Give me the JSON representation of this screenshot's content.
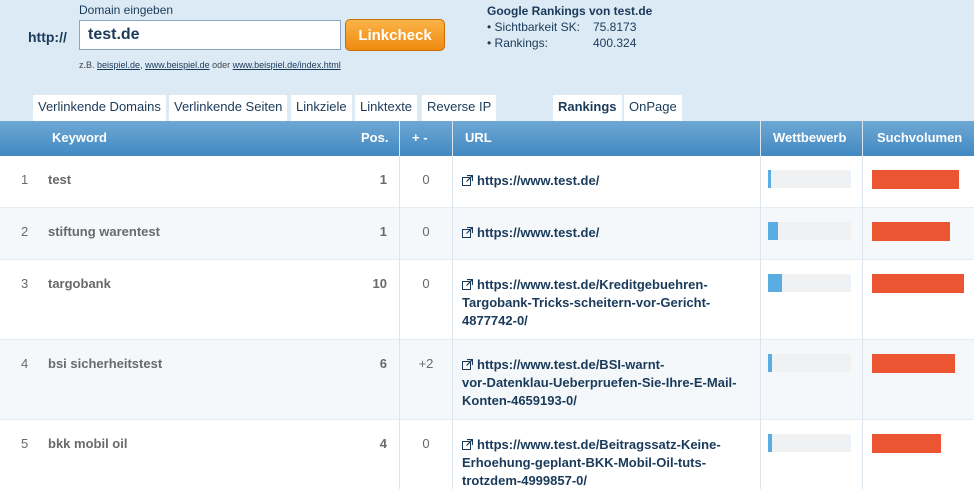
{
  "header": {
    "http_prefix": "http://",
    "domain_label": "Domain eingeben",
    "domain_value": "test.de",
    "check_button": "Linkcheck",
    "examples_prefix": "z.B.",
    "example_links": [
      "beispiel.de",
      "www.beispiel.de",
      "www.beispiel.de/index.html"
    ],
    "examples_sep1": ", ",
    "examples_sep2": " oder "
  },
  "rankings_summary": {
    "title": "Google Rankings von test.de",
    "visibility_label": "• Sichtbarkeit SK:",
    "visibility_value": "75.8173",
    "rankings_label": "• Rankings:",
    "rankings_value": "400.324"
  },
  "tabs": [
    {
      "label": "Verlinkende Domains",
      "active": false
    },
    {
      "label": "Verlinkende Seiten",
      "active": false
    },
    {
      "label": "Linkziele",
      "active": false
    },
    {
      "label": "Linktexte",
      "active": false
    },
    {
      "label": "Reverse IP",
      "active": false
    },
    {
      "label": "Rankings",
      "active": true
    },
    {
      "label": "OnPage",
      "active": false
    }
  ],
  "table": {
    "columns": {
      "keyword": "Keyword",
      "pos": "Pos.",
      "change": "+ -",
      "url": "URL",
      "competition": "Wettbewerb",
      "volume": "Suchvolumen"
    },
    "rows": [
      {
        "num": "1",
        "keyword": "test",
        "pos": "1",
        "change": "0",
        "url": [
          "https://www.test.de/"
        ],
        "competition": 0.0,
        "volume": 0.95
      },
      {
        "num": "2",
        "keyword": "stiftung warentest",
        "pos": "1",
        "change": "0",
        "url": [
          "https://www.test.de/"
        ],
        "competition": 0.12,
        "volume": 0.85
      },
      {
        "num": "3",
        "keyword": "targobank",
        "pos": "10",
        "change": "0",
        "url": [
          "https://www.test.de/Kreditgebuehren-",
          "Targobank-Tricks-scheitern-vor-Gericht-",
          "4877742-0/"
        ],
        "competition": 0.17,
        "volume": 1.0
      },
      {
        "num": "4",
        "keyword": "bsi sicherheitstest",
        "pos": "6",
        "change": "+2",
        "url": [
          "https://www.test.de/BSI-warnt-",
          "vor-Datenklau-Ueberpruefen-Sie-Ihre-E-Mail-",
          "Konten-4659193-0/"
        ],
        "competition": 0.05,
        "volume": 0.9
      },
      {
        "num": "5",
        "keyword": "bkk mobil oil",
        "pos": "4",
        "change": "0",
        "url": [
          "https://www.test.de/Beitragssatz-Keine-",
          "Erhoehung-geplant-BKK-Mobil-Oil-tuts-",
          "trotzdem-4999857-0/"
        ],
        "competition": 0.05,
        "volume": 0.75
      }
    ]
  },
  "colors": {
    "header_blue": "#4289c2",
    "competition_bar": "#5aade0",
    "volume_bar": "#eb5532",
    "button_orange": "#ee8a0f"
  }
}
